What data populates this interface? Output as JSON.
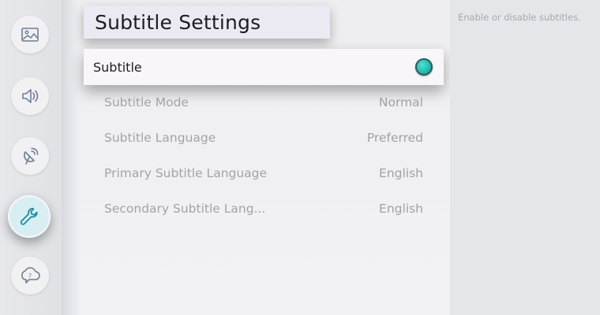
{
  "sidebar": {
    "items": [
      {
        "icon": "picture-icon"
      },
      {
        "icon": "sound-icon"
      },
      {
        "icon": "broadcast-icon"
      },
      {
        "icon": "wrench-icon",
        "active": true
      },
      {
        "icon": "support-chat-icon"
      }
    ]
  },
  "panel": {
    "title": "Subtitle Settings",
    "focused_item": {
      "label": "Subtitle",
      "toggle_on": true
    },
    "items": [
      {
        "label": "Subtitle Mode",
        "value": "Normal"
      },
      {
        "label": "Subtitle Language",
        "value": "Preferred"
      },
      {
        "label": "Primary Subtitle Language",
        "value": "English"
      },
      {
        "label": "Secondary Subtitle Lang...",
        "value": "English"
      }
    ]
  },
  "description": {
    "text": "Enable or disable subtitles."
  },
  "colors": {
    "accent": "#18b3a8",
    "active_icon": "#1f8fa0"
  }
}
